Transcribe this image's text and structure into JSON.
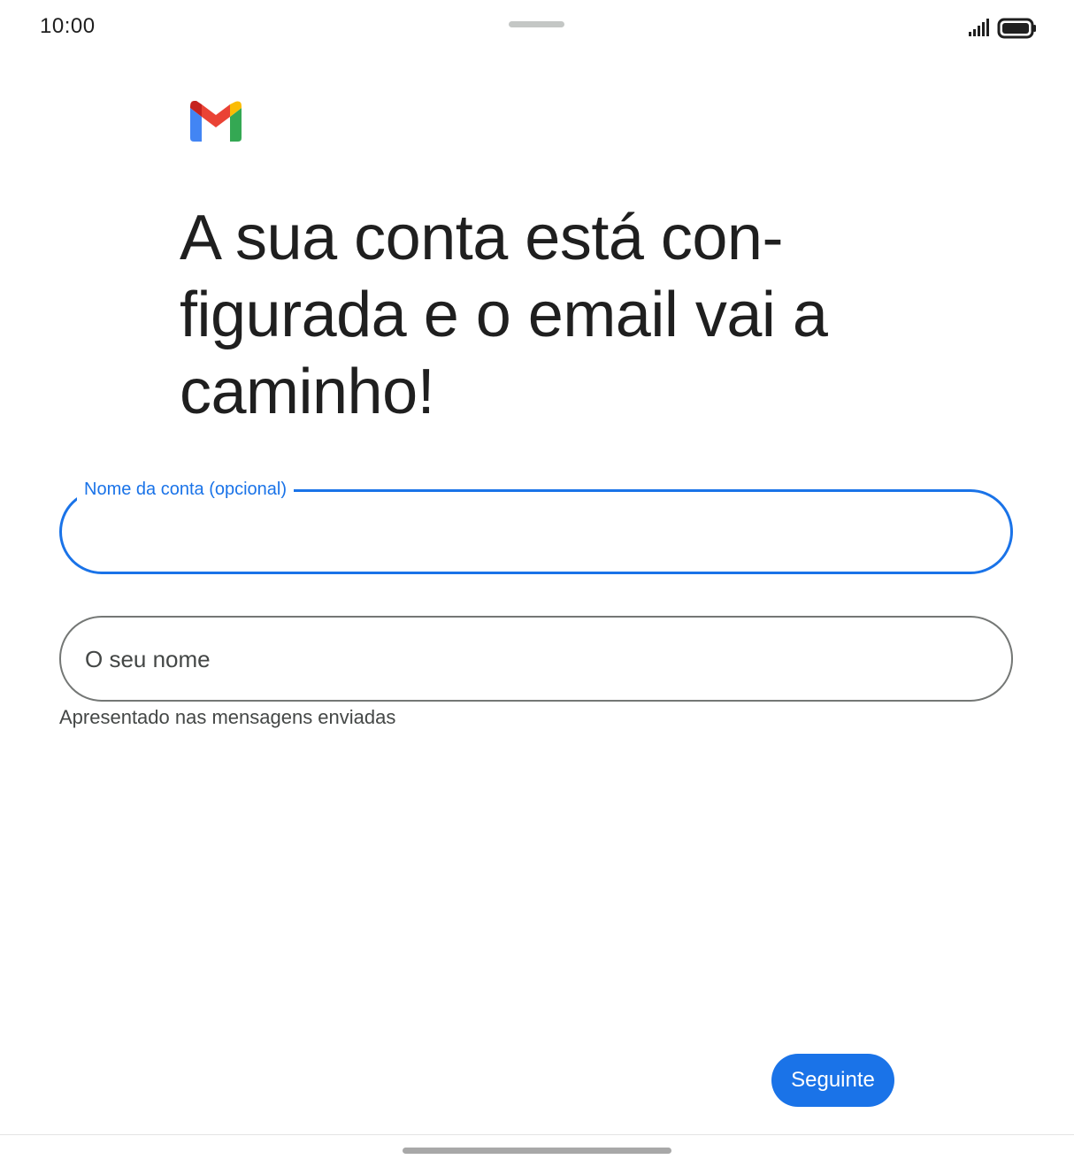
{
  "status_bar": {
    "time": "10:00",
    "icons": [
      "signal-icon",
      "battery-icon"
    ]
  },
  "logo": "gmail-logo",
  "title": "A sua conta está con-figurada e o email vai a caminho!",
  "title_lines": [
    "A sua conta está con-",
    "figurada e o email vai a",
    "caminho!"
  ],
  "account_name_field": {
    "label": "Nome da conta (opcional)",
    "value": ""
  },
  "your_name_field": {
    "placeholder": "O seu nome",
    "value": "",
    "helper": "Apresentado nas mensagens enviadas"
  },
  "next_button": {
    "label": "Seguinte"
  },
  "colors": {
    "accent": "#1a73e8",
    "text": "#1f1f1f",
    "secondary_text": "#444746",
    "outline": "#747775"
  }
}
